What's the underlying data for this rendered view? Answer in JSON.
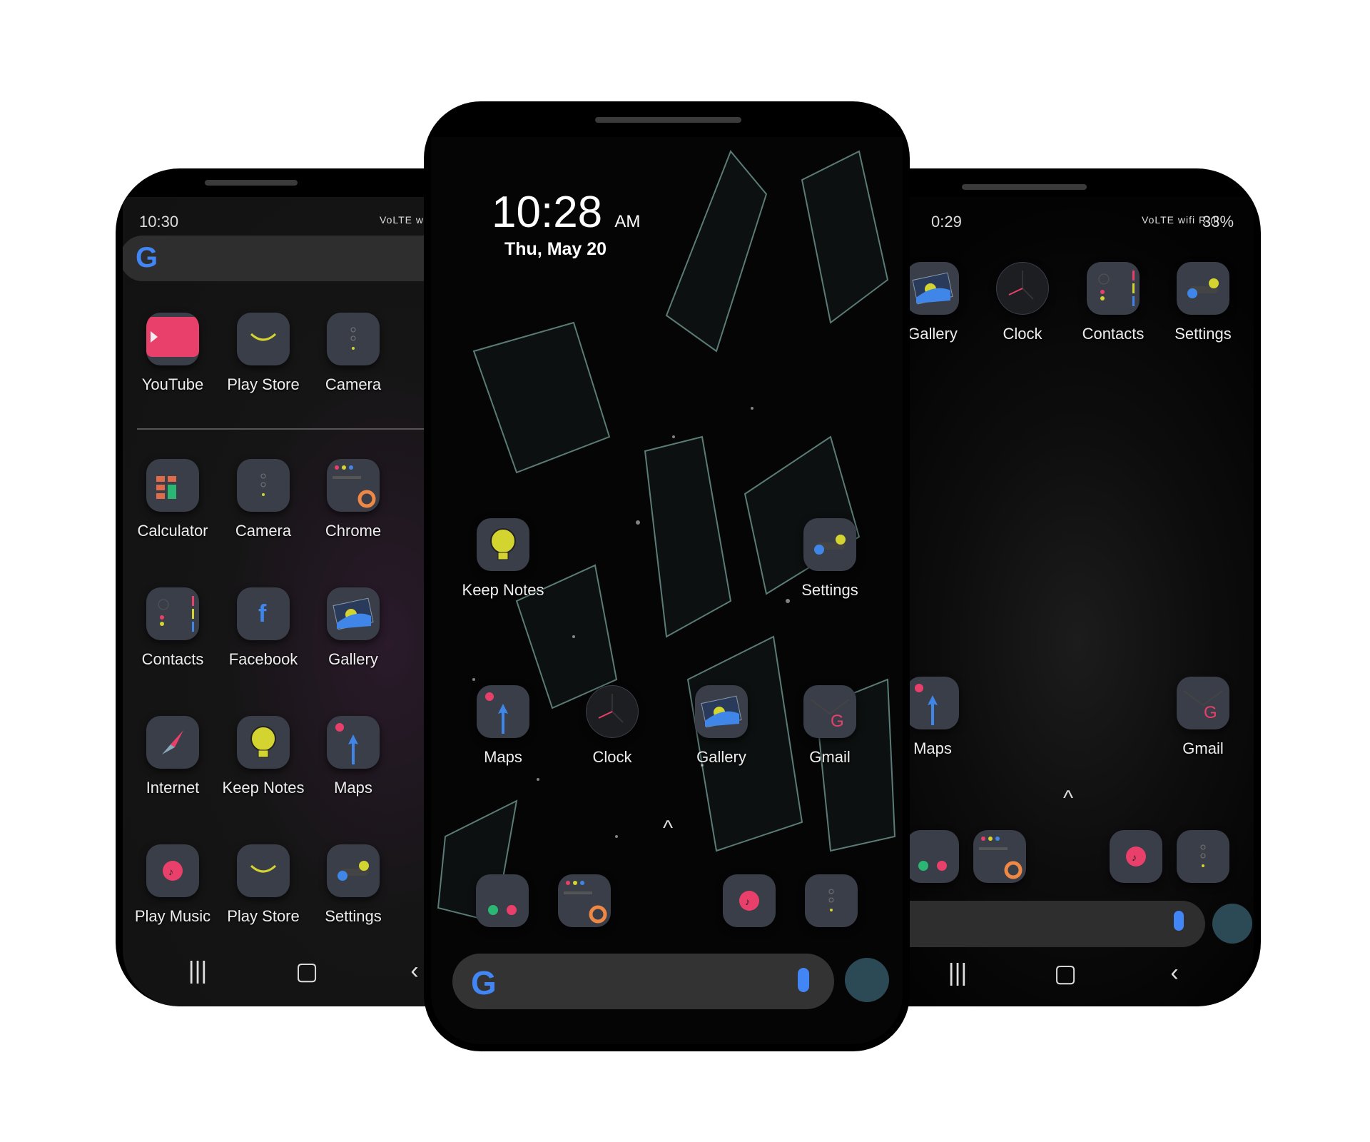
{
  "left_phone": {
    "status_time": "10:30",
    "status_icons": "VoLTE wifi R",
    "rows": [
      [
        {
          "label": "YouTube",
          "icon": "youtube"
        },
        {
          "label": "Play Store",
          "icon": "playstore"
        },
        {
          "label": "Camera",
          "icon": "camera"
        }
      ],
      [
        {
          "label": "Calculator",
          "icon": "calculator"
        },
        {
          "label": "Camera",
          "icon": "camera"
        },
        {
          "label": "Chrome",
          "icon": "chrome"
        }
      ],
      [
        {
          "label": "Contacts",
          "icon": "contacts"
        },
        {
          "label": "Facebook",
          "icon": "facebook"
        },
        {
          "label": "Gallery",
          "icon": "gallery"
        }
      ],
      [
        {
          "label": "Internet",
          "icon": "internet"
        },
        {
          "label": "Keep Notes",
          "icon": "keep"
        },
        {
          "label": "Maps",
          "icon": "maps"
        }
      ],
      [
        {
          "label": "Play Music",
          "icon": "music"
        },
        {
          "label": "Play Store",
          "icon": "playstore"
        },
        {
          "label": "Settings",
          "icon": "settings"
        }
      ]
    ],
    "nav": [
      "|||",
      "▢",
      "‹"
    ]
  },
  "center_phone": {
    "clock_time": "10:28",
    "clock_ampm": "AM",
    "date": "Thu, May 20",
    "apps": [
      {
        "label": "Keep Notes",
        "icon": "keep"
      },
      {
        "label": "Settings",
        "icon": "settings"
      },
      {
        "label": "Maps",
        "icon": "maps"
      },
      {
        "label": "Clock",
        "icon": "clock"
      },
      {
        "label": "Gallery",
        "icon": "gallery"
      },
      {
        "label": "Gmail",
        "icon": "gmail"
      }
    ],
    "dock": [
      {
        "icon": "phone"
      },
      {
        "icon": "chrome"
      },
      {
        "icon": "music"
      },
      {
        "icon": "camera"
      }
    ],
    "chevron": "^"
  },
  "right_phone": {
    "status_time": "0:29",
    "status_icons": "VoLTE wifi R.ıll",
    "battery": "33%",
    "apps": [
      {
        "label": "Gallery",
        "icon": "gallery"
      },
      {
        "label": "Clock",
        "icon": "clock"
      },
      {
        "label": "Contacts",
        "icon": "contacts"
      },
      {
        "label": "Settings",
        "icon": "settings"
      },
      {
        "label": "Maps",
        "icon": "maps"
      },
      {
        "label": "Gmail",
        "icon": "gmail"
      }
    ],
    "dock": [
      {
        "icon": "phone"
      },
      {
        "icon": "chrome"
      },
      {
        "icon": "music"
      },
      {
        "icon": "camera"
      }
    ],
    "chevron": "^",
    "nav": [
      "|||",
      "▢",
      "‹"
    ]
  },
  "colors": {
    "icon_bg": "#3a3e48",
    "pink": "#e8406a",
    "yellow": "#d4d430",
    "blue": "#3f86e8",
    "green": "#2bb673"
  }
}
